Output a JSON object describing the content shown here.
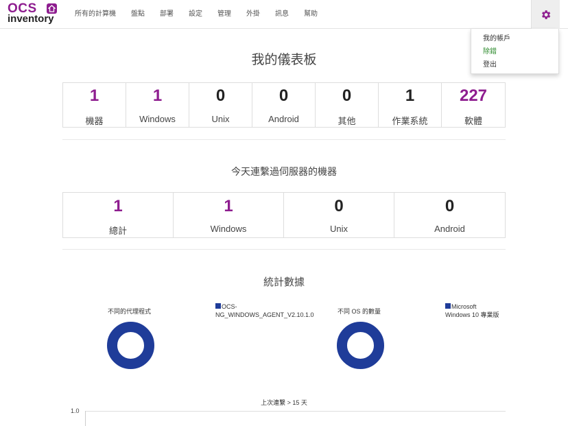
{
  "logo": {
    "line1": "OCS",
    "line2": "inventory"
  },
  "nav": {
    "items": [
      "所有的計算機",
      "盤點",
      "部署",
      "設定",
      "管理",
      "外掛",
      "訊息",
      "幫助"
    ]
  },
  "user_menu": {
    "items": [
      "我的帳戶",
      "除錯",
      "登出"
    ]
  },
  "dashboard": {
    "title": "我的儀表板",
    "stats": [
      {
        "value": "1",
        "label": "機器"
      },
      {
        "value": "1",
        "label": "Windows"
      },
      {
        "value": "0",
        "label": "Unix"
      },
      {
        "value": "0",
        "label": "Android"
      },
      {
        "value": "0",
        "label": "其他"
      },
      {
        "value": "1",
        "label": "作業系統"
      },
      {
        "value": "227",
        "label": "軟體"
      }
    ]
  },
  "today": {
    "title": "今天連繫過伺服器的機器",
    "stats": [
      {
        "value": "1",
        "label": "總計"
      },
      {
        "value": "1",
        "label": "Windows"
      },
      {
        "value": "0",
        "label": "Unix"
      },
      {
        "value": "0",
        "label": "Android"
      }
    ]
  },
  "statistics": {
    "title": "統計數據",
    "charts": [
      {
        "title": "不同的代理程式",
        "legend": [
          "OCS-",
          "NG_WINDOWS_AGENT_V2.10.1.0"
        ]
      },
      {
        "title": "不同 OS 的數量",
        "legend": [
          "Microsoft",
          "Windows 10 專業版"
        ]
      }
    ]
  },
  "last_contact": {
    "title": "上次連繫 > 15 天",
    "y_tick": "1.0"
  },
  "colors": {
    "brand": "#8e1d8f",
    "series": "#1f3c99"
  }
}
